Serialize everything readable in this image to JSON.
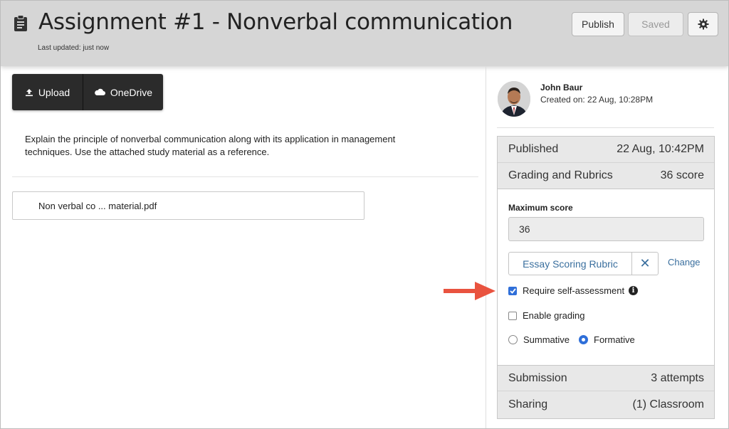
{
  "header": {
    "title": "Assignment #1 - Nonverbal communication",
    "last_updated": "Last updated: just now",
    "publish_label": "Publish",
    "saved_label": "Saved",
    "title_icon": "clipboard-icon",
    "settings_icon": "gear-icon"
  },
  "attach": {
    "upload_label": "Upload",
    "onedrive_label": "OneDrive",
    "upload_icon": "upload-icon",
    "onedrive_icon": "cloud-icon"
  },
  "description": "Explain the principle of nonverbal communication along with its application in management techniques. Use the attached study material as a reference.",
  "file": {
    "name": "Non verbal co ... material.pdf"
  },
  "author": {
    "name": "John Baur",
    "created_on": "Created on: 22 Aug, 10:28PM"
  },
  "panel": {
    "published_label": "Published",
    "published_value": "22 Aug, 10:42PM",
    "grading_label": "Grading and Rubrics",
    "grading_value": "36 score",
    "max_score_label": "Maximum score",
    "max_score_value": "36",
    "rubric_label": "Essay Scoring Rubric",
    "rubric_remove": "✕",
    "change_label": "Change",
    "self_assessment_label": "Require self-assessment",
    "self_assessment_checked": true,
    "enable_grading_label": "Enable grading",
    "enable_grading_checked": false,
    "summative_label": "Summative",
    "formative_label": "Formative",
    "selected_mode": "Formative",
    "submission_label": "Submission",
    "submission_value": "3 attempts",
    "sharing_label": "Sharing",
    "sharing_value": "(1) Classroom"
  },
  "colors": {
    "header_bg": "#d6d6d6",
    "upload_bg": "#2b2b2b",
    "link": "#3a6f9e",
    "checkbox_accent": "#2f6fd9",
    "arrow": "#e9533f"
  }
}
